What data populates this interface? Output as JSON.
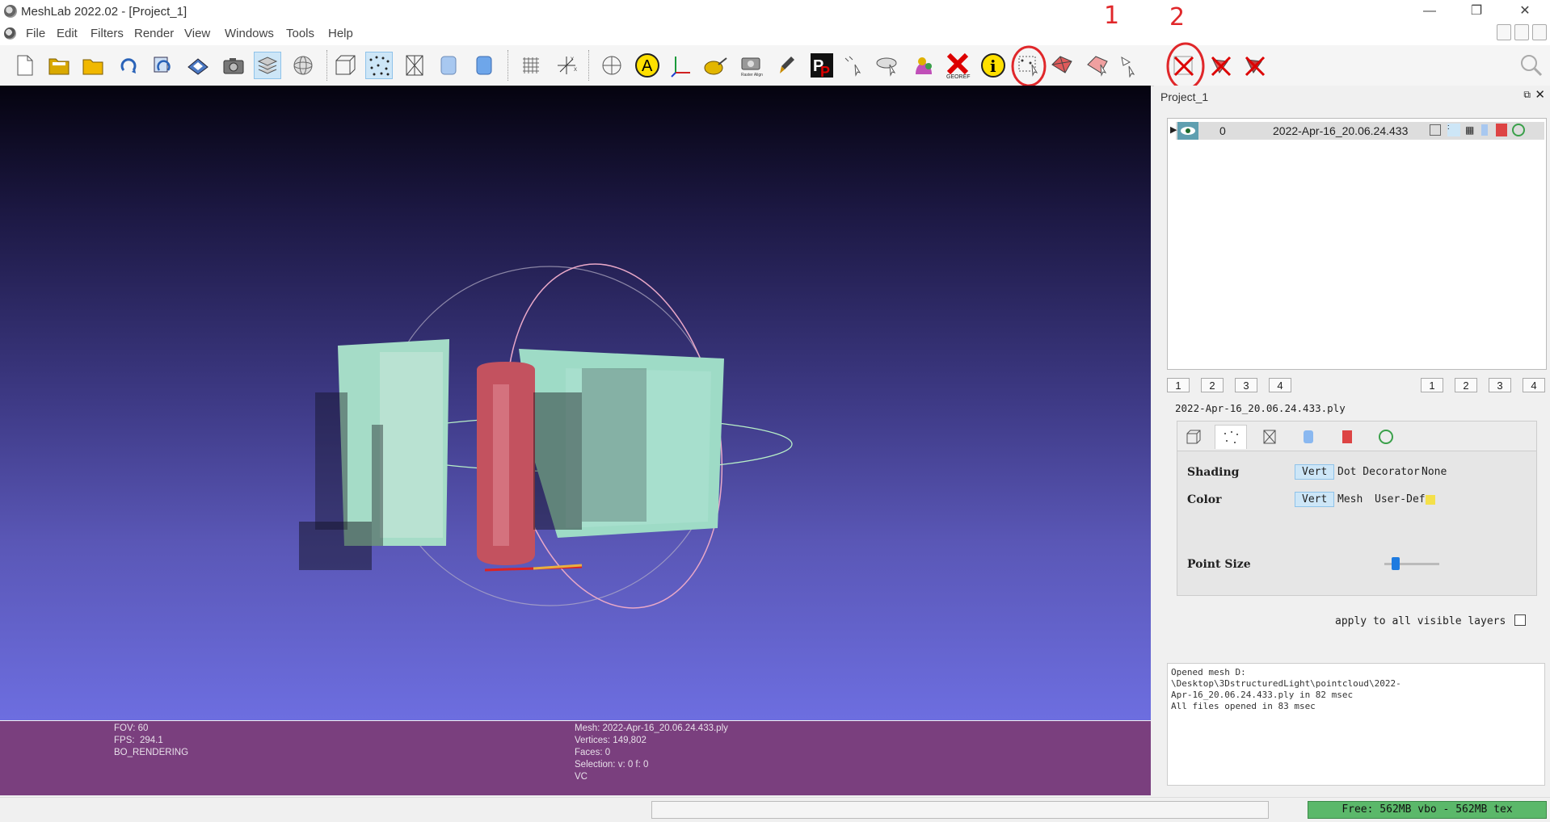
{
  "window": {
    "title": "MeshLab 2022.02 - [Project_1]"
  },
  "menu": [
    "File",
    "Edit",
    "Filters",
    "Render",
    "View",
    "Windows",
    "Tools",
    "Help"
  ],
  "colors": {
    "annotation": "#e0272a",
    "info_bar": "#7a3f7e",
    "memory_bar": "#5bb86a"
  },
  "toolbar_icons": [
    "new-project-icon",
    "open-project-icon",
    "import-mesh-icon",
    "reload-icon",
    "reload-all-icon",
    "export-mesh-icon",
    "snapshot-icon",
    "layers-icon",
    "trackball-icon",
    "bbox-icon",
    "points-icon",
    "wireframe-icon",
    "flat-icon",
    "smooth-icon",
    "grid-icon",
    "axes-icon",
    "sphere-icon",
    "label-icon",
    "axis-icon",
    "measure-icon",
    "raster-align-icon",
    "paint-icon",
    "pickpoints-icon",
    "manipulator-icon",
    "select-pick-icon",
    "texture-icon",
    "georef-icon",
    "info-icon",
    "select-vertices-icon",
    "select-faces-icon",
    "select-connected-icon",
    "select-conn-icon",
    "delete-vertices-icon",
    "delete-faces-icon",
    "delete-faces-vertices-icon",
    "search-icon"
  ],
  "annotations": {
    "mark1": "1",
    "mark2": "2",
    "mark_underline": "1"
  },
  "info": {
    "left": [
      "FOV: 60",
      "FPS:  294.1",
      "BO_RENDERING"
    ],
    "right": [
      "Mesh: 2022-Apr-16_20.06.24.433.ply",
      "Vertices: 149,802",
      "Faces: 0",
      "Selection: v: 0 f: 0",
      "VC"
    ]
  },
  "panel": {
    "title": "Project_1",
    "layer": {
      "index": "0",
      "name": "2022-Apr-16_20.06.24.433"
    },
    "view_buttons_left": [
      "1",
      "2",
      "3",
      "4"
    ],
    "view_buttons_right": [
      "1",
      "2",
      "3",
      "4"
    ],
    "filename": "2022-Apr-16_20.06.24.433.ply",
    "shading": {
      "label": "Shading",
      "options": [
        "Vert",
        "Dot Decorator",
        "None"
      ],
      "selected": "Vert"
    },
    "color": {
      "label": "Color",
      "options": [
        "Vert",
        "Mesh",
        "User-Def"
      ],
      "selected": "Vert",
      "user_color": "#f4e04a"
    },
    "point_size": {
      "label": "Point Size",
      "value_fraction": 0.2
    },
    "apply_all": "apply to all visible layers"
  },
  "log": "Opened mesh D:\n\\Desktop\\3DstructuredLight\\pointcloud\\2022-\nApr-16_20.06.24.433.ply in 82 msec\nAll files opened in 83 msec",
  "status": {
    "memory": "Free: 562MB vbo - 562MB tex"
  }
}
